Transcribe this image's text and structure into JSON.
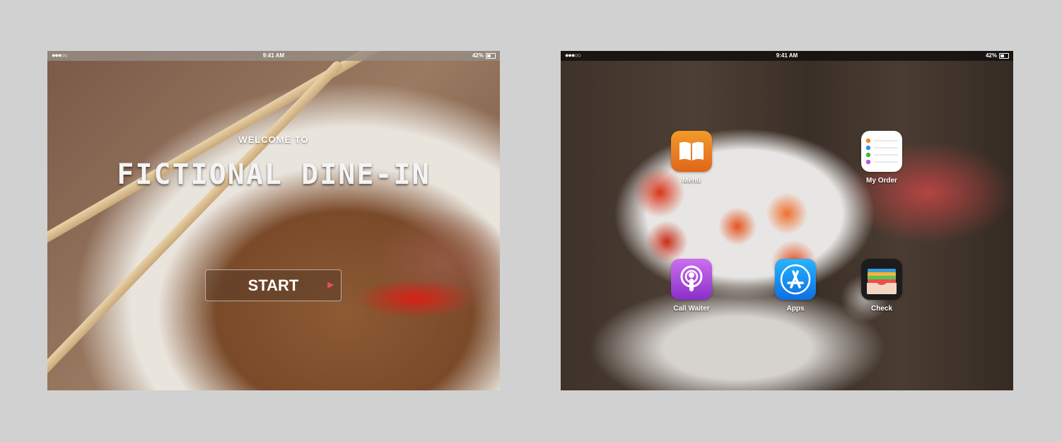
{
  "status_bar": {
    "signal": "●●●○○",
    "time": "9:41 AM",
    "battery": "42%"
  },
  "welcome": {
    "subtitle": "WELCOME TO",
    "title": "FICTIONAL DINE-IN",
    "start_label": "START",
    "start_arrow": "▶"
  },
  "home": {
    "apps": [
      {
        "label": "Menu",
        "icon": "book-icon",
        "color": "#e8731c"
      },
      {
        "label": "My Order",
        "icon": "list-icon",
        "color": "#ffffff"
      },
      {
        "label": "Call Waiter",
        "icon": "podcast-icon",
        "color": "#b54ce0"
      },
      {
        "label": "Apps",
        "icon": "app-store-icon",
        "color": "#1a8cf0"
      },
      {
        "label": "Check",
        "icon": "wallet-icon",
        "color": "#1a1a1a"
      }
    ]
  }
}
